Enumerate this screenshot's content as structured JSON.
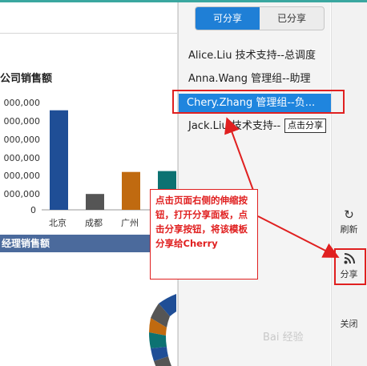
{
  "share_panel": {
    "tabs": [
      {
        "label": "可分享",
        "active": true
      },
      {
        "label": "已分享",
        "active": false
      }
    ],
    "users": [
      {
        "label": "Alice.Liu 技术支持--总调度",
        "selected": false
      },
      {
        "label": "Anna.Wang 管理组--助理",
        "selected": false
      },
      {
        "label": "Chery.Zhang 管理组--负...",
        "selected": true
      },
      {
        "label": "Jack.Liu 技术支持--",
        "selected": false
      }
    ],
    "tooltip": "点击分享"
  },
  "side_rail": {
    "refresh_label": "刷新",
    "share_label": "分享",
    "close_label": "关闭"
  },
  "report": {
    "title": "公司销售额",
    "section_title": "经理销售额"
  },
  "chart_data": {
    "type": "bar",
    "title": "公司销售额",
    "y_tick_labels": [
      "000,000",
      "000,000",
      "000,000",
      "000,000",
      "000,000",
      "000,000",
      "0"
    ],
    "categories": [
      "北京",
      "成都",
      "广州",
      ""
    ],
    "values": [
      5.65,
      0.9,
      2.15,
      2.2
    ],
    "colors": [
      "#1f4e96",
      "#555555",
      "#c06a10",
      "#0c7272"
    ],
    "ylim": [
      0,
      6
    ]
  },
  "annotation": {
    "text": "点击页面右侧的伸缩按钮，打开分享面板，点击分享按钮，将该模板分享给Cherry",
    "color": "#e02020"
  },
  "watermark": "Bai 经验"
}
